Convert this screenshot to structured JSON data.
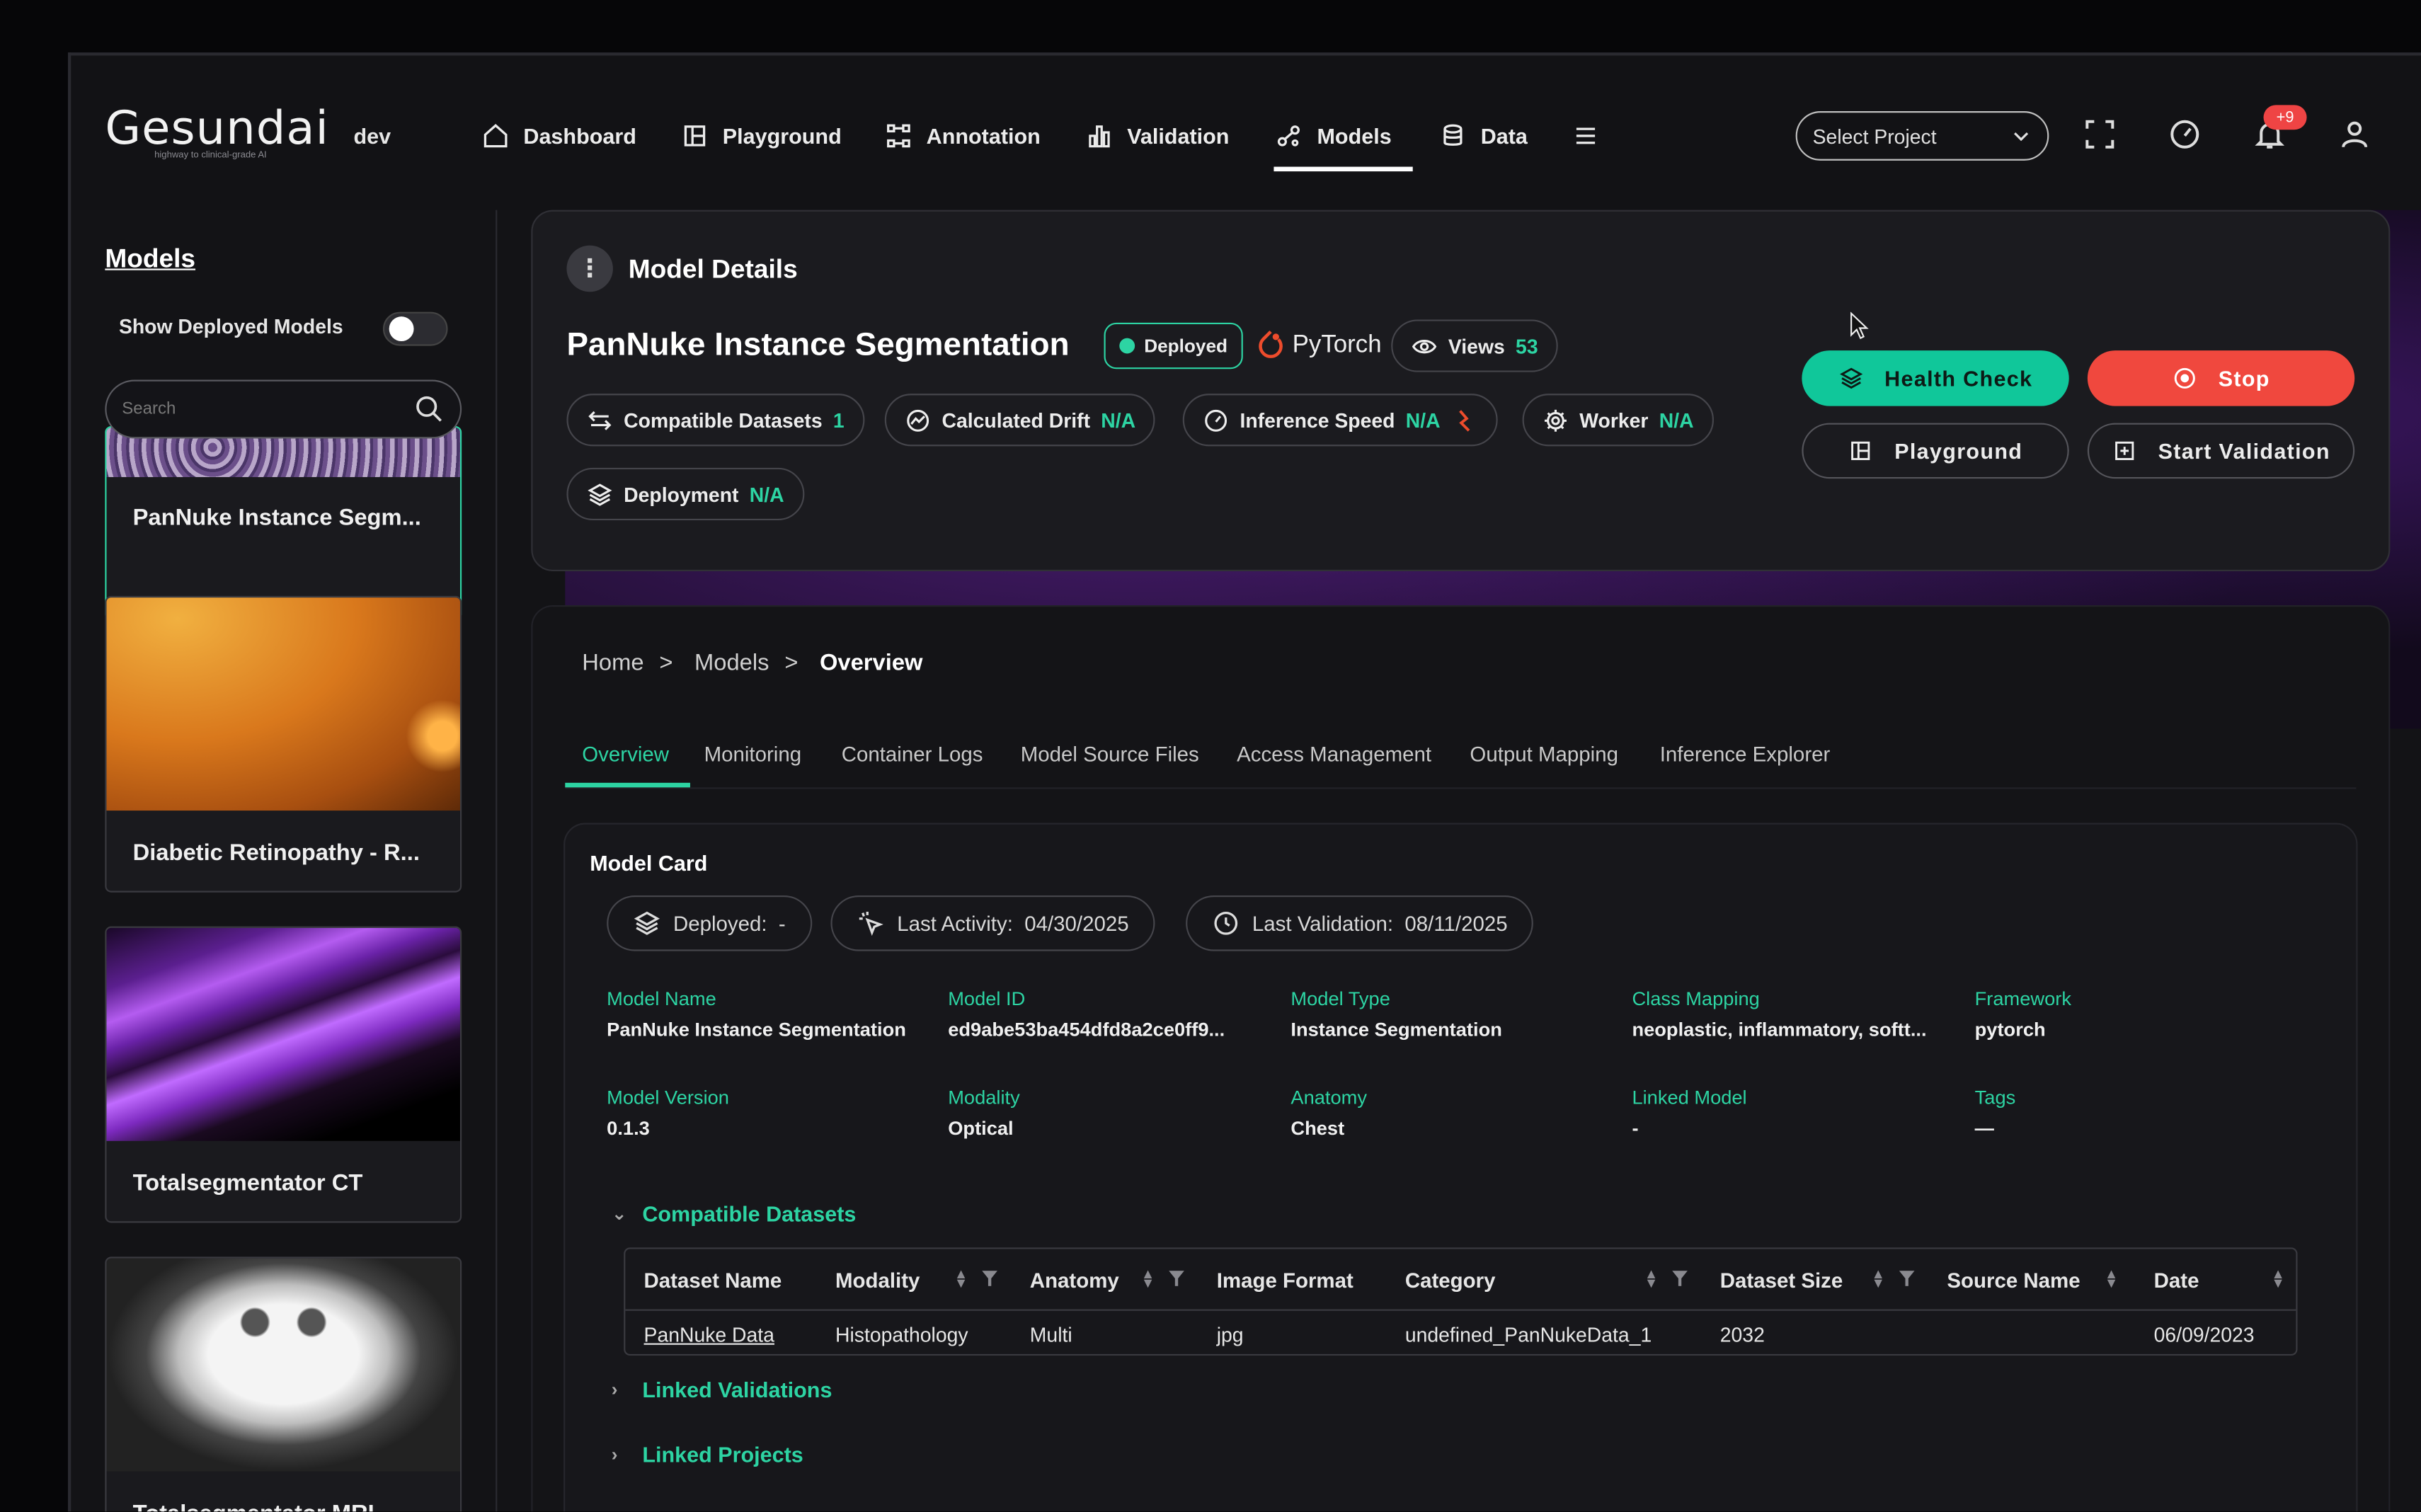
{
  "app": {
    "logo_text": "Gesundai",
    "logo_tagline": "highway to clinical-grade AI",
    "env": "dev"
  },
  "nav": {
    "items": [
      {
        "label": "Dashboard",
        "icon": "home-icon"
      },
      {
        "label": "Playground",
        "icon": "layout-icon"
      },
      {
        "label": "Annotation",
        "icon": "annotation-icon"
      },
      {
        "label": "Validation",
        "icon": "bar-chart-icon"
      },
      {
        "label": "Models",
        "icon": "models-icon",
        "active": true
      },
      {
        "label": "Data",
        "icon": "database-icon"
      }
    ],
    "project_placeholder": "Select Project",
    "notification_count": "+9"
  },
  "sidebar": {
    "title": "Models",
    "toggle_label": "Show Deployed Models",
    "search_placeholder": "Search",
    "cards": [
      {
        "label": "PanNuke Instance Segm...",
        "active": true
      },
      {
        "label": "Diabetic Retinopathy - R..."
      },
      {
        "label": "Totalsegmentator CT"
      },
      {
        "label": "Totalsegmentator MRI"
      }
    ]
  },
  "details": {
    "section_title": "Model Details",
    "model_title": "PanNuke Instance Segmentation",
    "status": "Deployed",
    "framework_logo": "PyTorch",
    "views_label": "Views",
    "views_count": "53",
    "pills": [
      {
        "label": "Compatible Datasets",
        "value": "1"
      },
      {
        "label": "Calculated Drift",
        "value": "N/A"
      },
      {
        "label": "Inference Speed",
        "value": "N/A"
      },
      {
        "label": "Worker",
        "value": "N/A"
      },
      {
        "label": "Deployment",
        "value": "N/A"
      }
    ],
    "buttons": {
      "health_check": "Health Check",
      "stop": "Stop",
      "playground": "Playground",
      "start_validation": "Start Validation"
    }
  },
  "breadcrumb": [
    "Home",
    ">",
    "Models",
    ">",
    "Overview"
  ],
  "tabs": [
    "Overview",
    "Monitoring",
    "Container Logs",
    "Model Source Files",
    "Access Management",
    "Output Mapping",
    "Inference Explorer"
  ],
  "model_card": {
    "title": "Model Card",
    "deployed": "Deployed:  -",
    "last_activity": "Last Activity:  04/30/2025",
    "last_validation": "Last Validation:  08/11/2025",
    "fields": [
      {
        "key": "Model Name",
        "value": "PanNuke Instance Segmentation"
      },
      {
        "key": "Model ID",
        "value": "ed9abe53ba454dfd8a2ce0ff9..."
      },
      {
        "key": "Model Type",
        "value": "Instance Segmentation"
      },
      {
        "key": "Class Mapping",
        "value": "neoplastic, inflammatory, softt..."
      },
      {
        "key": "Framework",
        "value": "pytorch"
      },
      {
        "key": "Model Version",
        "value": "0.1.3"
      },
      {
        "key": "Modality",
        "value": "Optical"
      },
      {
        "key": "Anatomy",
        "value": "Chest"
      },
      {
        "key": "Linked Model",
        "value": "-"
      },
      {
        "key": "Tags",
        "value": "—"
      }
    ],
    "sections": {
      "compatible": "Compatible Datasets",
      "validations": "Linked Validations",
      "projects": "Linked Projects"
    },
    "table": {
      "headers": [
        "Dataset Name",
        "Modality",
        "Anatomy",
        "Image Format",
        "Category",
        "Dataset Size",
        "Source Name",
        "Date"
      ],
      "rows": [
        [
          "PanNuke Data",
          "Histopathology",
          "Multi",
          "jpg",
          "undefined_PanNukeData_1",
          "2032",
          "",
          "06/09/2023"
        ]
      ]
    }
  },
  "colors": {
    "accent": "#2dd4a3",
    "danger": "#f0483e",
    "background": "#131316"
  }
}
